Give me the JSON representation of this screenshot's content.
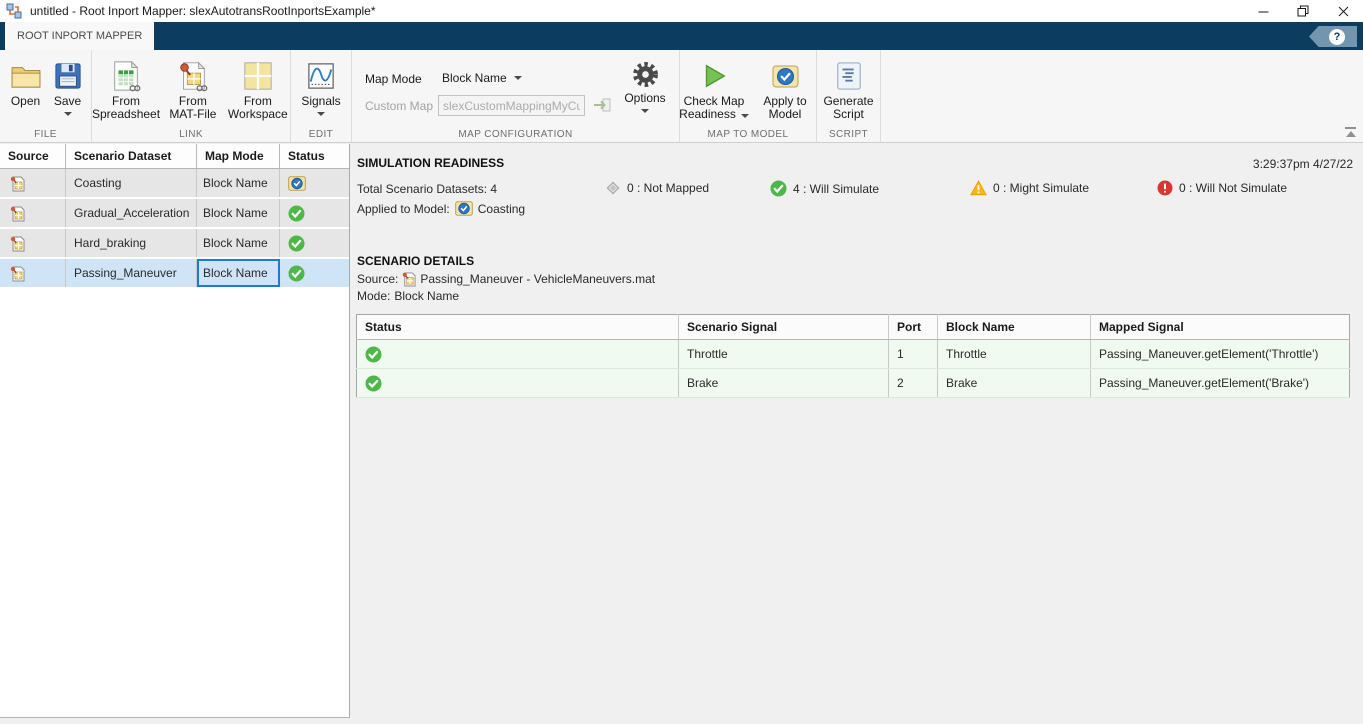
{
  "title_bar": {
    "title": "untitled - Root Inport Mapper: slexAutotransRootInportsExample*"
  },
  "tab_strip": {
    "tab_label": "ROOT INPORT MAPPER"
  },
  "ribbon": {
    "file": {
      "section_label": "FILE",
      "open_label": "Open",
      "save_label": "Save"
    },
    "link": {
      "section_label": "LINK",
      "from_spreadsheet_line1": "From",
      "from_spreadsheet_line2": "Spreadsheet",
      "from_mat_line1": "From",
      "from_mat_line2": "MAT-File",
      "from_workspace_line1": "From",
      "from_workspace_line2": "Workspace"
    },
    "edit": {
      "section_label": "EDIT",
      "signals_label": "Signals"
    },
    "map_configuration": {
      "section_label": "MAP CONFIGURATION",
      "map_mode_label": "Map Mode",
      "map_mode_value": "Block Name",
      "custom_map_label": "Custom Map",
      "custom_map_value": "slexCustomMappingMyCu",
      "options_label": "Options"
    },
    "map_to_model": {
      "section_label": "MAP TO MODEL",
      "check_line1": "Check Map",
      "check_line2": "Readiness",
      "apply_line1": "Apply to",
      "apply_line2": "Model"
    },
    "script": {
      "section_label": "SCRIPT",
      "generate_line1": "Generate",
      "generate_line2": "Script"
    }
  },
  "scenario_table": {
    "headers": [
      "Source",
      "Scenario Dataset",
      "Map Mode",
      "Status"
    ],
    "rows": [
      {
        "dataset": "Coasting",
        "map_mode": "Block Name",
        "status": "applied-to-model"
      },
      {
        "dataset": "Gradual_Acceleration",
        "map_mode": "Block Name",
        "status": "will-simulate"
      },
      {
        "dataset": "Hard_braking",
        "map_mode": "Block Name",
        "status": "will-simulate"
      },
      {
        "dataset": "Passing_Maneuver",
        "map_mode": "Block Name",
        "status": "will-simulate"
      }
    ]
  },
  "simulation_readiness": {
    "heading": "SIMULATION READINESS",
    "timestamp": "3:29:37pm 4/27/22",
    "total_datasets": "Total Scenario Datasets: 4",
    "applied_label": "Applied to Model:",
    "applied_value": "Coasting",
    "not_mapped": "0 : Not Mapped",
    "will_simulate": "4 : Will Simulate",
    "might_simulate": "0 : Might Simulate",
    "will_not_simulate": "0 : Will Not Simulate"
  },
  "scenario_details": {
    "heading": "SCENARIO DETAILS",
    "source_label": "Source:",
    "source_value": "Passing_Maneuver - VehicleManeuvers.mat",
    "mode_label": "Mode:",
    "mode_value": "Block Name"
  },
  "details_table": {
    "headers": [
      "Status",
      "Scenario Signal",
      "Port",
      "Block Name",
      "Mapped Signal"
    ],
    "rows": [
      {
        "status": "will-simulate",
        "scenario_signal": "Throttle",
        "port": "1",
        "block_name": "Throttle",
        "mapped_signal": "Passing_Maneuver.getElement('Throttle')"
      },
      {
        "status": "will-simulate",
        "scenario_signal": "Brake",
        "port": "2",
        "block_name": "Brake",
        "mapped_signal": "Passing_Maneuver.getElement('Brake')"
      }
    ]
  },
  "icons": {
    "not_mapped": "gray-diamond",
    "will_simulate": "green-check-circle",
    "might_simulate": "yellow-warning-triangle",
    "will_not_simulate": "red-error-circle",
    "applied_to_model": "blue-check-badge",
    "source_file": "mat-file-with-pin"
  },
  "colors": {
    "toolstrip_navy": "#0d3c61",
    "selection_blue": "#cfe5f7",
    "selection_border": "#1f78d1",
    "success_green": "#4db848",
    "warning_yellow": "#fcb517",
    "error_red": "#d53a2f",
    "row_gray": "#e6e6e6",
    "detail_row_green": "#f1faf0"
  }
}
